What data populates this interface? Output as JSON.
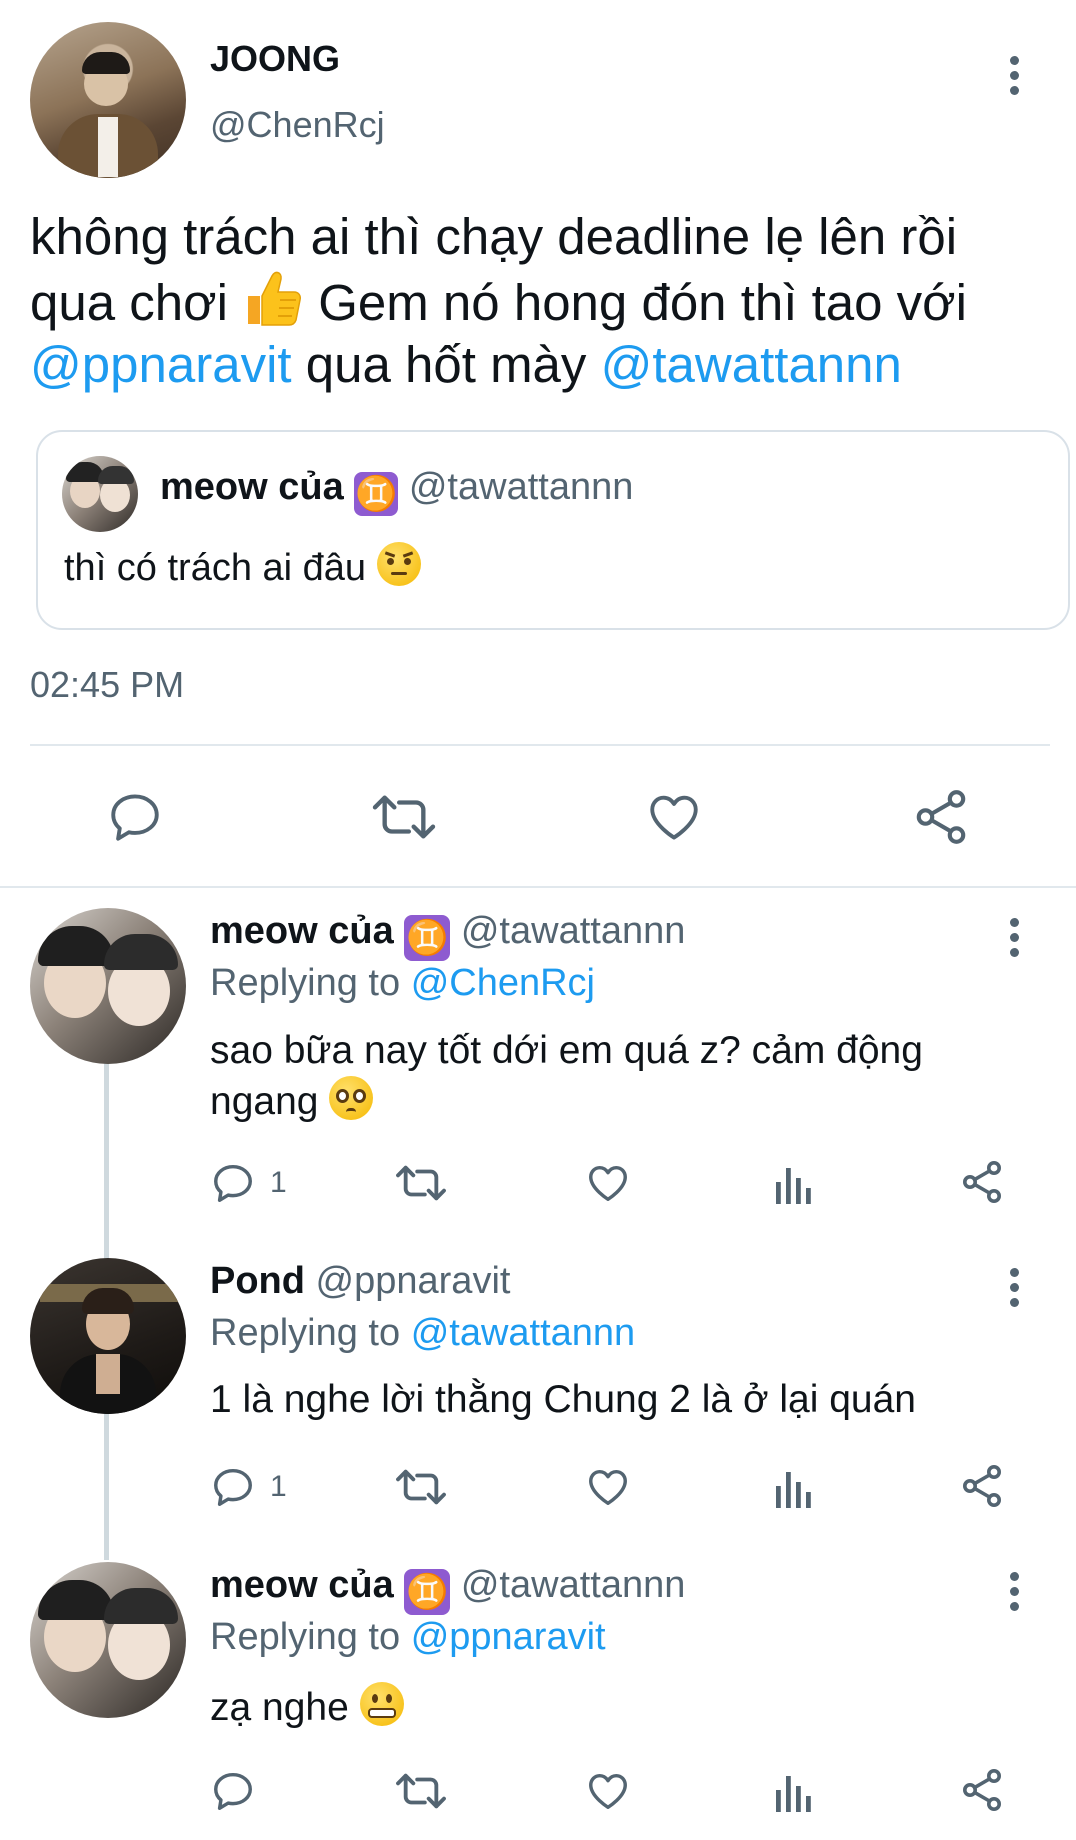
{
  "main_tweet": {
    "display_name": "JOONG",
    "handle": "@ChenRcj",
    "text_line1": "không trách ai thì chạy deadline lẹ lên rồi",
    "text_line2a": "qua chơi",
    "text_line2b": "Gem nó hong đón thì tao với",
    "mention1": "@ppnaravit",
    "text_line3": "qua hốt mày",
    "mention2": "@tawattannn",
    "timestamp": "02:45 PM",
    "quoted": {
      "display_name": "meow của",
      "badge": "♊",
      "handle": "@tawattannn",
      "text": "thì có trách ai đâu"
    }
  },
  "replies": [
    {
      "display_name": "meow của",
      "badge": "♊",
      "handle": "@tawattannn",
      "replying_prefix": "Replying to",
      "replying_to": "@ChenRcj",
      "text_line1": "sao bữa nay tốt dới em quá z? cảm động",
      "text_line2": "ngang",
      "reply_count": "1"
    },
    {
      "display_name": "Pond",
      "handle": "@ppnaravit",
      "replying_prefix": "Replying to",
      "replying_to": "@tawattannn",
      "text_line1": "1 là nghe lời thằng Chung 2 là ở lại quán",
      "reply_count": "1"
    },
    {
      "display_name": "meow của",
      "badge": "♊",
      "handle": "@tawattannn",
      "replying_prefix": "Replying to",
      "replying_to": "@ppnaravit",
      "text_line1": "zạ nghe",
      "reply_count": ""
    }
  ],
  "icons": {
    "reply": "reply-icon",
    "retweet": "retweet-icon",
    "like": "like-icon",
    "share": "share-icon",
    "analytics": "analytics-icon",
    "more": "more-options-icon"
  },
  "colors": {
    "link": "#1d9bf0",
    "muted": "#536471",
    "gemini_badge": "#8e5bd0"
  }
}
